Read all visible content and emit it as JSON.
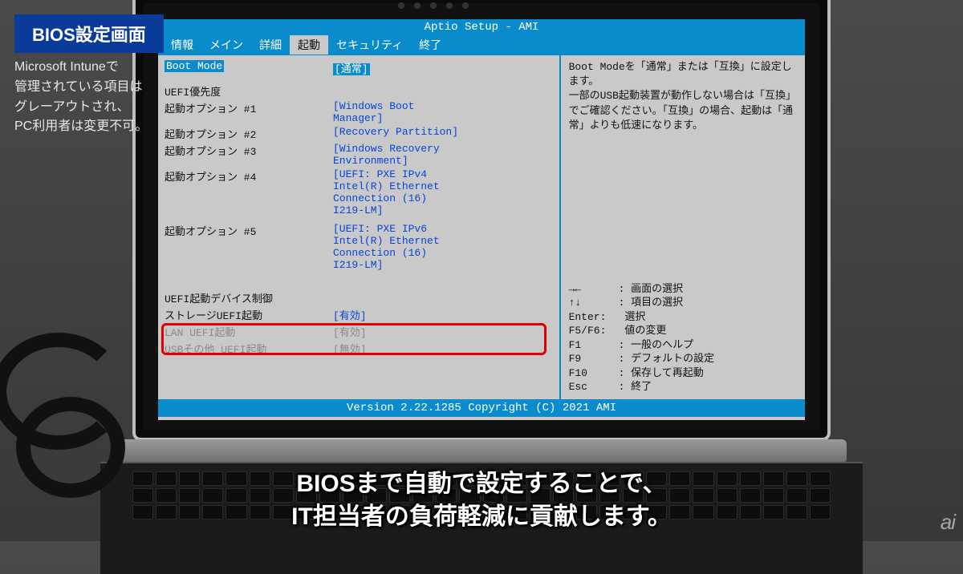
{
  "overlay": {
    "label": "BIOS設定画面",
    "desc": "Microsoft Intuneで\n管理されている項目は\nグレーアウトされ、\nPC利用者は変更不可。"
  },
  "caption": "BIOSまで自動で設定することで、\nIT担当者の負荷軽減に貢献します。",
  "watermark": "ai",
  "bios": {
    "title": "Aptio Setup - AMI",
    "tabs": [
      "情報",
      "メイン",
      "詳細",
      "起動",
      "セキュリティ",
      "終了"
    ],
    "active_tab_index": 3,
    "selected": {
      "label": "Boot Mode",
      "value": "[通常]"
    },
    "items": [
      {
        "label": "UEFI優先度",
        "value": ""
      },
      {
        "label": "起動オプション #1",
        "value": "[Windows Boot\nManager]"
      },
      {
        "label": "起動オプション #2",
        "value": "[Recovery Partition]"
      },
      {
        "label": "起動オプション #3",
        "value": "[Windows Recovery\nEnvironment]"
      },
      {
        "label": "起動オプション #4",
        "value": "[UEFI: PXE IPv4\nIntel(R) Ethernet\nConnection (16)\nI219-LM]"
      },
      {
        "label": "起動オプション #5",
        "value": "[UEFI: PXE IPv6\nIntel(R) Ethernet\nConnection (16)\nI219-LM]"
      }
    ],
    "device_ctrl_header": "UEFI起動デバイス制御",
    "device_ctrl": [
      {
        "label": "ストレージUEFI起動",
        "value": "[有効]",
        "gray": false
      },
      {
        "label": "LAN UEFI起動",
        "value": "[有効]",
        "gray": true
      },
      {
        "label": "USBその他 UEFI起動",
        "value": "[無効]",
        "gray": true
      }
    ],
    "help_text": "Boot Modeを「通常」または「互換」に設定します。\n一部のUSB起動装置が動作しない場合は「互換」でご確認ください。「互換」の場合、起動は「通常」よりも低速になります。",
    "keys": [
      {
        "k": "→←",
        "d": "画面の選択"
      },
      {
        "k": "↑↓",
        "d": "項目の選択"
      },
      {
        "k": "Enter:",
        "d": "選択"
      },
      {
        "k": "F5/F6:",
        "d": "値の変更"
      },
      {
        "k": "F1",
        "d": "一般のヘルプ"
      },
      {
        "k": "F9",
        "d": "デフォルトの設定"
      },
      {
        "k": "F10",
        "d": "保存して再起動"
      },
      {
        "k": "Esc",
        "d": "終了"
      }
    ],
    "footer": "Version 2.22.1285 Copyright (C) 2021 AMI"
  }
}
